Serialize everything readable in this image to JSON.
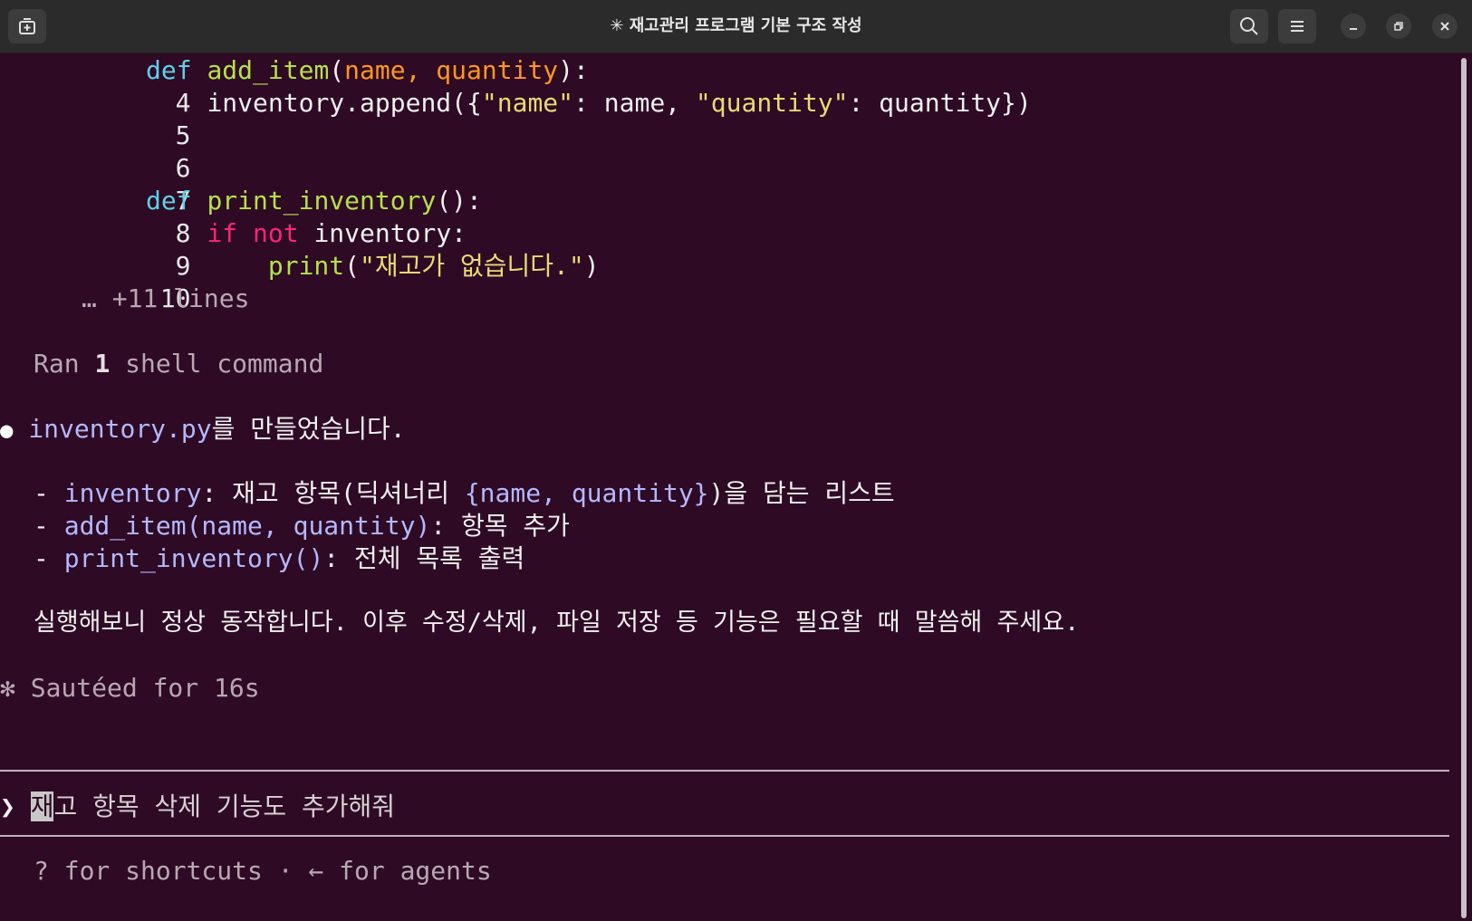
{
  "window": {
    "title": "✳ 재고관리 프로그램 기본 구조 작성"
  },
  "code": {
    "l4": {
      "num": "4",
      "kw": "def",
      "fn": "add_item",
      "open": "(",
      "params": "name, quantity",
      "close": "):"
    },
    "l5": {
      "num": "5",
      "a": "inventory.append({",
      "k1": "\"name\"",
      "b": ": name, ",
      "k2": "\"quantity\"",
      "c": ": quantity})"
    },
    "l6": {
      "num": "6"
    },
    "l7": {
      "num": "7"
    },
    "l8": {
      "num": "8",
      "kw": "def",
      "fn": "print_inventory",
      "rest": "():"
    },
    "l9": {
      "num": "9",
      "if": "if",
      "not": "not",
      "rest": "inventory:"
    },
    "l10": {
      "num": "10",
      "fn": "print",
      "open": "(",
      "str": "\"재고가 없습니다.\"",
      "close": ")"
    },
    "more": "… +11 lines"
  },
  "ran": {
    "pre": "Ran ",
    "count": "1",
    "post": " shell command"
  },
  "message": {
    "bullet": "●",
    "file": "inventory.py",
    "rest": "를 만들었습니다.",
    "items": [
      {
        "dash": "- ",
        "code": "inventory",
        "text": ": 재고 항목(딕셔너리 ",
        "code2": "{name, quantity}",
        "text2": ")을 담는 리스트"
      },
      {
        "dash": "- ",
        "code": "add_item(name, quantity)",
        "text": ": 항목 추가"
      },
      {
        "dash": "- ",
        "code": "print_inventory()",
        "text": ": 전체 목록 출력"
      }
    ],
    "summary": "실행해보니 정상 동작합니다. 이후 수정/삭제, 파일 저장 등 기능은 필요할 때 말씀해 주세요."
  },
  "status": {
    "icon": "✻",
    "text": "Sautéed for 16s"
  },
  "prompt": {
    "marker": "❯",
    "cursor_char": "재",
    "rest": "고 항목 삭제 기능도 추가해줘"
  },
  "footer": {
    "hint": "? for shortcuts · ← for agents"
  }
}
